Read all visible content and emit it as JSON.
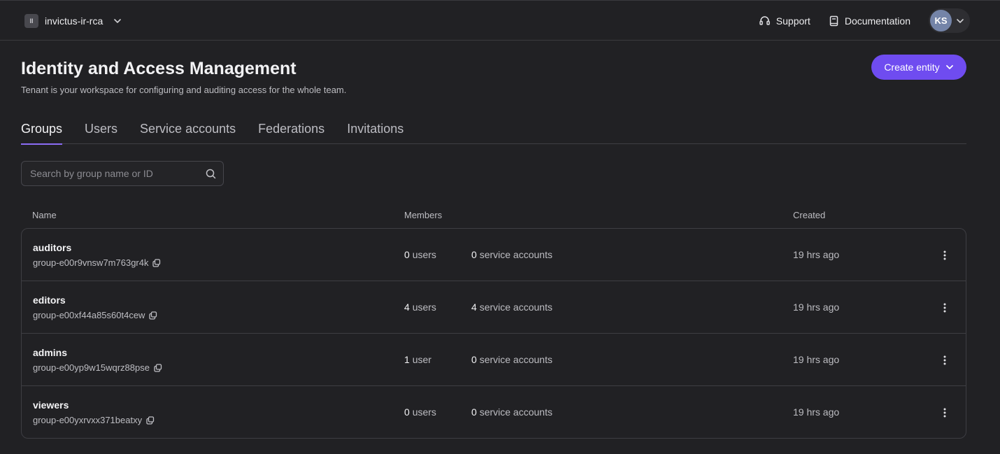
{
  "topbar": {
    "tenant_badge": "II",
    "tenant_name": "invictus-ir-rca",
    "support_label": "Support",
    "documentation_label": "Documentation",
    "avatar_initials": "KS"
  },
  "header": {
    "title": "Identity and Access Management",
    "subtitle": "Tenant is your workspace for configuring and auditing access for the whole team.",
    "create_button_label": "Create entity"
  },
  "tabs": [
    {
      "label": "Groups",
      "active": true
    },
    {
      "label": "Users",
      "active": false
    },
    {
      "label": "Service accounts",
      "active": false
    },
    {
      "label": "Federations",
      "active": false
    },
    {
      "label": "Invitations",
      "active": false
    }
  ],
  "search": {
    "placeholder": "Search by group name or ID",
    "value": ""
  },
  "table": {
    "columns": {
      "name": "Name",
      "members": "Members",
      "created": "Created"
    },
    "rows": [
      {
        "name": "auditors",
        "id": "group-e00r9vnsw7m763gr4k",
        "users_count": "0",
        "users_label": "users",
        "sa_count": "0",
        "sa_label": "service accounts",
        "created": "19 hrs ago"
      },
      {
        "name": "editors",
        "id": "group-e00xf44a85s60t4cew",
        "users_count": "4",
        "users_label": "users",
        "sa_count": "4",
        "sa_label": "service accounts",
        "created": "19 hrs ago"
      },
      {
        "name": "admins",
        "id": "group-e00yp9w15wqrz88pse",
        "users_count": "1",
        "users_label": "user",
        "sa_count": "0",
        "sa_label": "service accounts",
        "created": "19 hrs ago"
      },
      {
        "name": "viewers",
        "id": "group-e00yxrvxx371beatxy",
        "users_count": "0",
        "users_label": "users",
        "sa_count": "0",
        "sa_label": "service accounts",
        "created": "19 hrs ago"
      }
    ]
  },
  "colors": {
    "background": "#212124",
    "accent": "#6f4cf0",
    "tab_underline": "#8b6cf5",
    "avatar": "#7484a8"
  }
}
